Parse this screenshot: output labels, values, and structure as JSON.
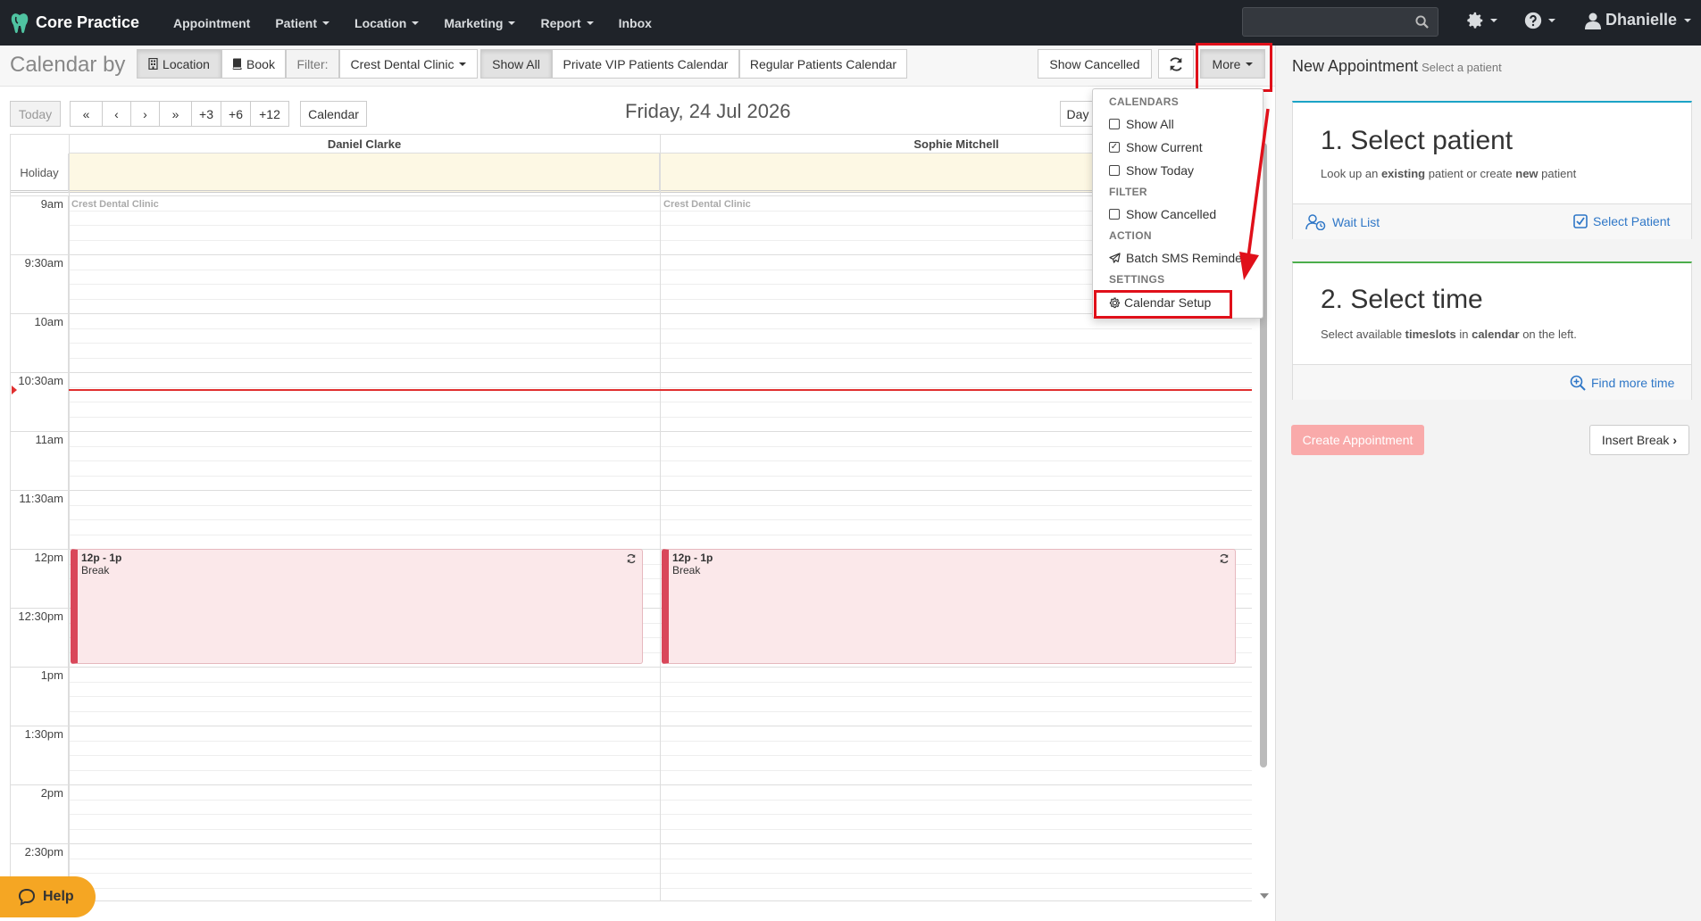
{
  "app": {
    "brand": "Core Practice",
    "nav": [
      {
        "label": "Appointment",
        "caret": false
      },
      {
        "label": "Patient",
        "caret": true
      },
      {
        "label": "Location",
        "caret": true
      },
      {
        "label": "Marketing",
        "caret": true
      },
      {
        "label": "Report",
        "caret": true
      },
      {
        "label": "Inbox",
        "caret": false
      }
    ],
    "search_placeholder": "",
    "user": "Dhanielle"
  },
  "toolbar": {
    "title": "Calendar by",
    "location_btn": "Location",
    "book_btn": "Book",
    "filter_label": "Filter:",
    "clinic": "Crest Dental Clinic",
    "show_all": "Show All",
    "vip_calendar": "Private VIP Patients Calendar",
    "regular_calendar": "Regular Patients Calendar",
    "show_cancelled": "Show Cancelled",
    "more": "More"
  },
  "calnav": {
    "today": "Today",
    "first": "«",
    "prev": "‹",
    "next": "›",
    "last": "»",
    "plus3": "+3",
    "plus6": "+6",
    "plus12": "+12",
    "calendar": "Calendar",
    "date": "Friday, 24 Jul 2026",
    "day": "Day"
  },
  "grid": {
    "holiday": "Holiday",
    "columns": [
      {
        "name": "Daniel Clarke",
        "location": "Crest Dental Clinic"
      },
      {
        "name": "Sophie Mitchell",
        "location": "Crest Dental Clinic"
      }
    ],
    "times": [
      "9am",
      "9:30am",
      "10am",
      "10:30am",
      "11am",
      "11:30am",
      "12pm",
      "12:30pm",
      "1pm",
      "1:30pm",
      "2pm",
      "2:30pm"
    ],
    "events": [
      {
        "time": "12p - 1p",
        "title": "Break"
      },
      {
        "time": "12p - 1p",
        "title": "Break"
      }
    ]
  },
  "dropdown": {
    "calendars_head": "CALENDARS",
    "show_all": "Show All",
    "show_current": "Show Current",
    "show_today": "Show Today",
    "filter_head": "FILTER",
    "show_cancelled": "Show Cancelled",
    "action_head": "ACTION",
    "batch_sms": "Batch SMS Reminder",
    "settings_head": "SETTINGS",
    "calendar_setup": "Calendar Setup"
  },
  "panel": {
    "title": "New Appointment",
    "subtitle": "Select a patient",
    "step1_title": "1. Select patient",
    "step1_desc_a": "Look up an ",
    "step1_desc_b": "existing",
    "step1_desc_c": " patient or create ",
    "step1_desc_d": "new",
    "step1_desc_e": " patient",
    "wait_list": "Wait List",
    "select_patient": "Select Patient",
    "step2_title": "2. Select time",
    "step2_desc_a": "Select available ",
    "step2_desc_b": "timeslots",
    "step2_desc_c": " in ",
    "step2_desc_d": "calendar",
    "step2_desc_e": " on the left.",
    "find_more": "Find more time",
    "create": "Create Appointment",
    "insert_break": "Insert Break"
  },
  "help": "Help",
  "colors": {
    "navbar": "#1f2329",
    "step1_accent": "#1ba3c6",
    "step2_accent": "#4cae4c",
    "annotation": "#e0101a",
    "break_bar": "#d9475a",
    "help": "#f5a623"
  }
}
